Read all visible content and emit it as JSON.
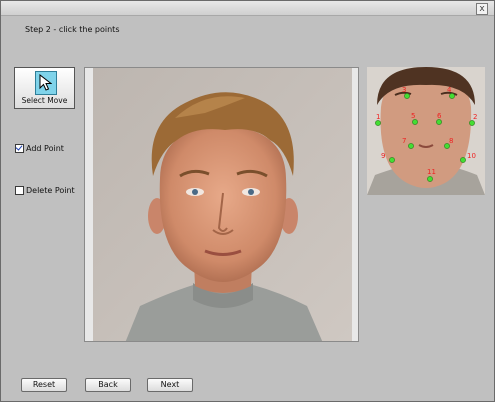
{
  "window": {
    "close_glyph": "x"
  },
  "header": {
    "step_label": "Step 2 - click the points"
  },
  "tools": {
    "select_move_label": "Select Move",
    "select_move_icon": "cursor-arrow-icon",
    "add_point": {
      "label": "Add Point",
      "checked": true
    },
    "delete_point": {
      "label": "Delete Point",
      "checked": false
    }
  },
  "reference": {
    "points": [
      {
        "label": "1"
      },
      {
        "label": "2"
      },
      {
        "label": "3"
      },
      {
        "label": "4"
      },
      {
        "label": "5"
      },
      {
        "label": "6"
      },
      {
        "label": "7"
      },
      {
        "label": "8"
      },
      {
        "label": "9"
      },
      {
        "label": "10"
      },
      {
        "label": "11"
      }
    ],
    "point_color": "#44dd33",
    "label_color": "#ee2222"
  },
  "buttons": {
    "reset": "Reset",
    "back": "Back",
    "next": "Next"
  }
}
